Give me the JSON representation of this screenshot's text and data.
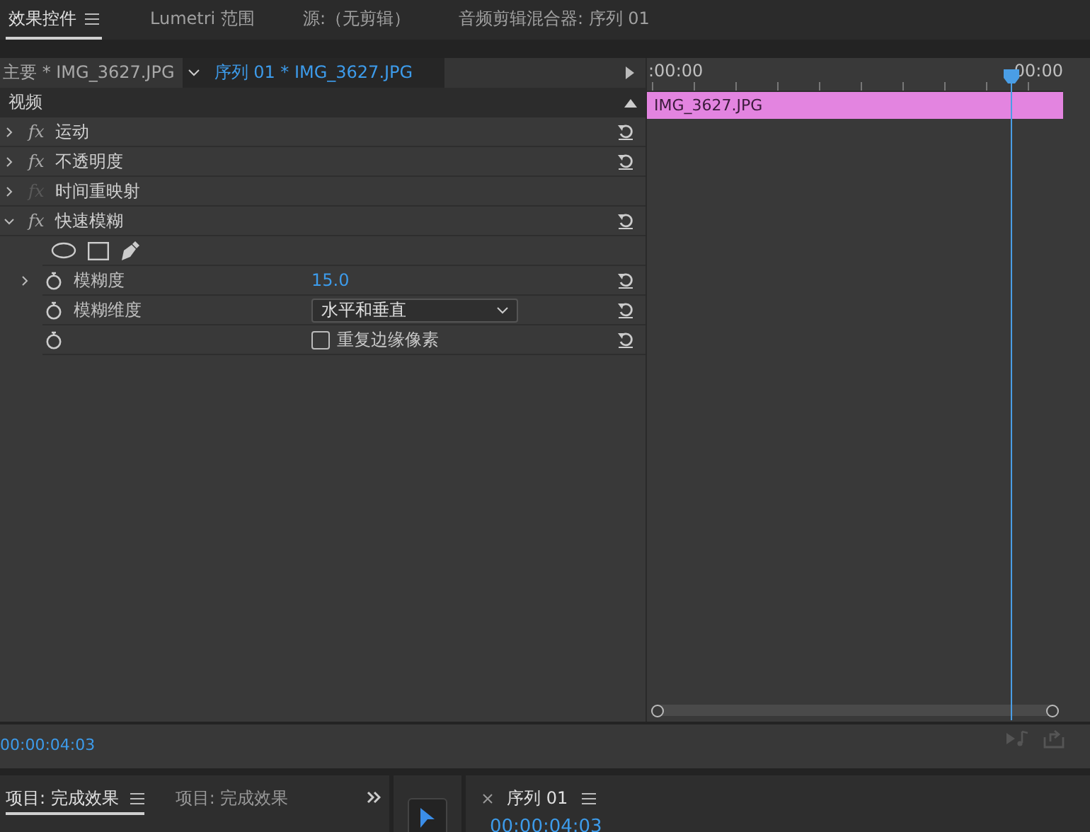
{
  "tabs": [
    {
      "label": "效果控件",
      "selected": true,
      "menu": true
    },
    {
      "label": "Lumetri 范围",
      "selected": false,
      "menu": false
    },
    {
      "label": "源:（无剪辑）",
      "selected": false,
      "menu": false
    },
    {
      "label": "音频剪辑混合器: 序列 01",
      "selected": false,
      "menu": false
    }
  ],
  "clip_header": {
    "master": "主要 * IMG_3627.JPG",
    "sequence": "序列 01 * IMG_3627.JPG"
  },
  "section": {
    "label": "视频",
    "expanded": true
  },
  "effects": [
    {
      "badge": "fx",
      "name": "运动",
      "expanded": false,
      "disabled": false
    },
    {
      "badge": "fx",
      "name": "不透明度",
      "expanded": false,
      "disabled": false
    },
    {
      "badge": "fx",
      "name": "时间重映射",
      "expanded": false,
      "disabled": true
    },
    {
      "badge": "fx",
      "name": "快速模糊",
      "expanded": true,
      "disabled": false,
      "children": [
        {
          "kind": "masks"
        },
        {
          "kind": "number",
          "label": "模糊度",
          "value": "15.0",
          "expandable": true
        },
        {
          "kind": "dropdown",
          "label": "模糊维度",
          "value": "水平和垂直",
          "expandable": false
        },
        {
          "kind": "checkbox",
          "label": "重复边缘像素",
          "checked": false,
          "expandable": false
        }
      ]
    }
  ],
  "timeline": {
    "ruler_start": ":00:00",
    "ruler_end": "00:00",
    "clip": "IMG_3627.JPG"
  },
  "current_time": "00:00:04:03",
  "project_tabs": [
    {
      "label": "项目: 完成效果",
      "selected": true
    },
    {
      "label": "项目: 完成效果",
      "selected": false
    }
  ],
  "sequence_panel": {
    "tab": "序列 01",
    "timecode": "00:00:04:03"
  }
}
